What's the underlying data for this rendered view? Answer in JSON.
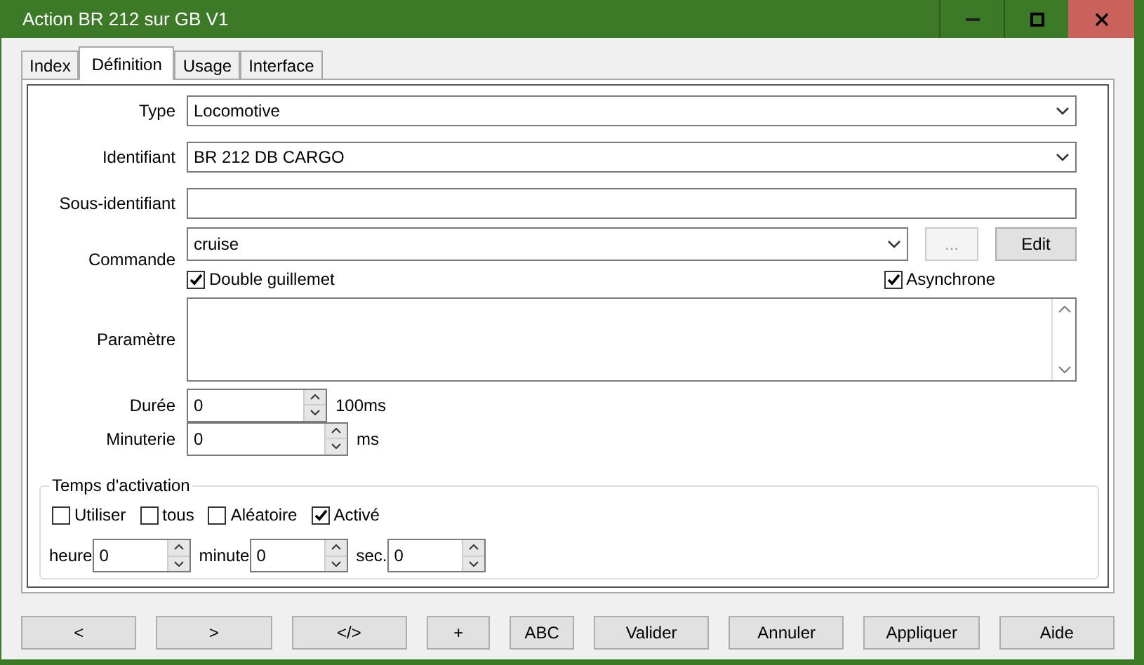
{
  "window": {
    "title": "Action BR 212 sur GB V1"
  },
  "tabs": [
    {
      "label": "Index",
      "selected": false
    },
    {
      "label": "Définition",
      "selected": true
    },
    {
      "label": "Usage",
      "selected": false
    },
    {
      "label": "Interface",
      "selected": false
    }
  ],
  "form": {
    "type": {
      "label": "Type",
      "value": "Locomotive"
    },
    "identifiant": {
      "label": "Identifiant",
      "value": "BR 212 DB CARGO"
    },
    "sous_identifiant": {
      "label": "Sous-identifiant"
    },
    "commande": {
      "label": "Commande",
      "value": "cruise",
      "browse_button": "...",
      "edit_button": "Edit"
    },
    "double_guillemet": {
      "label": "Double guillemet",
      "checked": true
    },
    "asynchrone": {
      "label": "Asynchrone",
      "checked": true
    },
    "parametre": {
      "label": "Paramètre"
    },
    "duree": {
      "label": "Durée",
      "value": "0",
      "unit": "100ms"
    },
    "minuterie": {
      "label": "Minuterie",
      "value": "0",
      "unit": "ms"
    }
  },
  "activation": {
    "title": "Temps d'activation",
    "checkboxes": [
      {
        "label": "Utiliser",
        "checked": false
      },
      {
        "label": "tous",
        "checked": false
      },
      {
        "label": "Aléatoire",
        "checked": false
      },
      {
        "label": "Activé",
        "checked": true
      }
    ],
    "fields": [
      {
        "label": "heure",
        "value": "0"
      },
      {
        "label": "minute",
        "value": "0"
      },
      {
        "label": "sec.",
        "value": "0"
      }
    ]
  },
  "buttons": [
    "<",
    ">",
    "</>",
    "+",
    "ABC",
    "Valider",
    "Annuler",
    "Appliquer",
    "Aide"
  ]
}
